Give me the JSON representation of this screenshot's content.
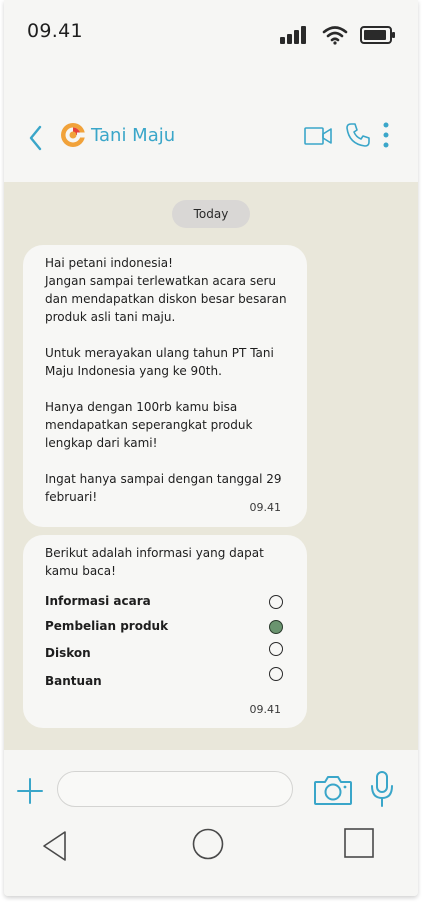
{
  "status_bar": {
    "time": "09.41",
    "icons": [
      "cellular-signal-icon",
      "wifi-icon",
      "battery-icon"
    ]
  },
  "header": {
    "title": "Tani Maju",
    "icons": [
      "back-arrow-icon",
      "brand-logo",
      "video-call-icon",
      "phone-icon",
      "more-vertical-icon"
    ]
  },
  "chat": {
    "date_label": "Today",
    "messages": [
      {
        "lines": [
          "Hai petani indonesia!",
          "Jangan sampai terlewatkan acara seru",
          "dan mendapatkan diskon besar besaran",
          "produk asli tani maju.",
          "",
          "Untuk merayakan ulang tahun PT Tani",
          "Maju Indonesia yang ke 90th.",
          "",
          "Hanya dengan 100rb kamu bisa",
          "mendapatkan seperangkat produk",
          "lengkap dari kami!",
          "",
          "Ingat hanya sampai dengan tanggal 29",
          "februari!"
        ],
        "time": "09.41"
      },
      {
        "lines": [
          "Berikut adalah informasi yang dapat",
          "kamu baca!"
        ],
        "options": [
          {
            "label": "Informasi acara",
            "selected": false
          },
          {
            "label": "Pembelian produk",
            "selected": true
          },
          {
            "label": "Diskon",
            "selected": false
          },
          {
            "label": "Bantuan",
            "selected": false
          }
        ],
        "time": "09.41"
      }
    ]
  },
  "input_bar": {
    "placeholder": "",
    "icons": [
      "plus-icon",
      "camera-icon",
      "microphone-icon"
    ]
  },
  "nav_bar": {
    "icons": [
      "nav-back-triangle-icon",
      "nav-home-circle-icon",
      "nav-recent-square-icon"
    ]
  },
  "colors": {
    "accent": "#3aa6c9",
    "chat_background": "#e9e7da",
    "bubble": "#f7f7f5",
    "radio_selected": "#6a946f",
    "date_pill": "#d9d7d5"
  }
}
